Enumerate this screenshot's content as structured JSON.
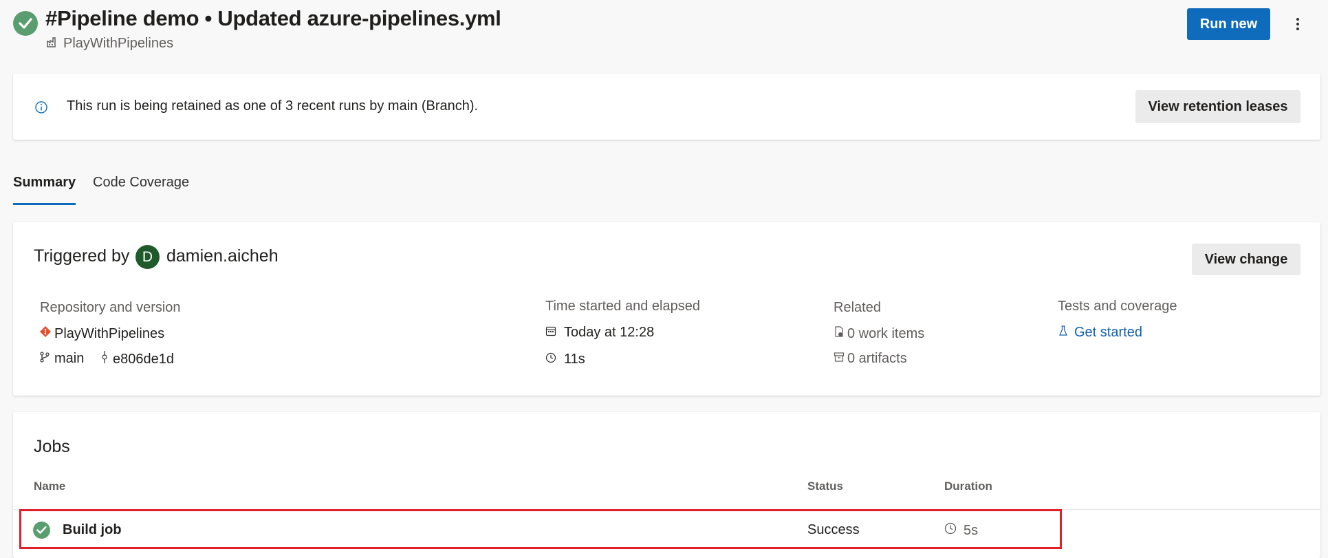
{
  "header": {
    "title": "#Pipeline demo • Updated azure-pipelines.yml",
    "pipeline_name": "PlayWithPipelines",
    "run_new_label": "Run new"
  },
  "retention": {
    "message": "This run is being retained as one of 3 recent runs by main (Branch).",
    "button_label": "View retention leases"
  },
  "tabs": [
    {
      "label": "Summary",
      "selected": true
    },
    {
      "label": "Code Coverage",
      "selected": false
    }
  ],
  "summary": {
    "triggered_label": "Triggered by",
    "avatar_initial": "D",
    "triggered_user": "damien.aicheh",
    "view_change_label": "View change",
    "repository": {
      "heading": "Repository and version",
      "repo_name": "PlayWithPipelines",
      "branch": "main",
      "commit": "e806de1d"
    },
    "time": {
      "heading": "Time started and elapsed",
      "started": "Today at 12:28",
      "elapsed": "11s"
    },
    "related": {
      "heading": "Related",
      "work_items": "0 work items",
      "artifacts": "0 artifacts"
    },
    "tests": {
      "heading": "Tests and coverage",
      "link": "Get started"
    }
  },
  "jobs": {
    "title": "Jobs",
    "columns": {
      "name": "Name",
      "status": "Status",
      "duration": "Duration"
    },
    "rows": [
      {
        "name": "Build job",
        "status": "Success",
        "duration": "5s"
      }
    ]
  },
  "colors": {
    "accent": "#0f6cbd",
    "success": "#5a9e6f",
    "highlight_border": "#e0202a",
    "repo_icon": "#e2502f",
    "avatar": "#1e5a2a"
  }
}
